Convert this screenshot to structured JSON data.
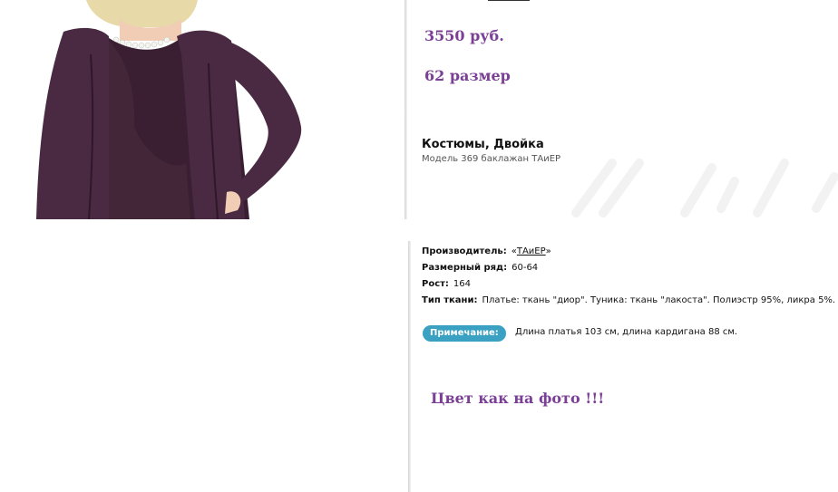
{
  "product": {
    "price": "3550 руб.",
    "size": "62 размер",
    "title": "Костюмы, Двойка",
    "model": "Модель 369 баклажан ТАиЕР"
  },
  "specs": {
    "manufacturer_label": "Производитель:",
    "manufacturer_open": "«",
    "manufacturer_link": "ТАиЕР",
    "manufacturer_close": "»",
    "sizes_label": "Размерный ряд:",
    "sizes_value": "60-64",
    "height_label": "Рост:",
    "height_value": "164",
    "fabric_label": "Тип ткани:",
    "fabric_value": "Платье: ткань \"диор\". Туника: ткань \"лакоста\". Полиэстр 95%, ликра 5%."
  },
  "note": {
    "badge": "Примечание:",
    "text": "Длина платья 103 см, длина кардигана 88 см."
  },
  "color_note": "Цвет как на фото !!!",
  "colors": {
    "accent_purple": "#7b3f96",
    "badge_blue": "#3aa1c2",
    "garment": "#3a1f33"
  },
  "image": {
    "subject": "model wearing eggplant-colored dress and cardigan"
  }
}
